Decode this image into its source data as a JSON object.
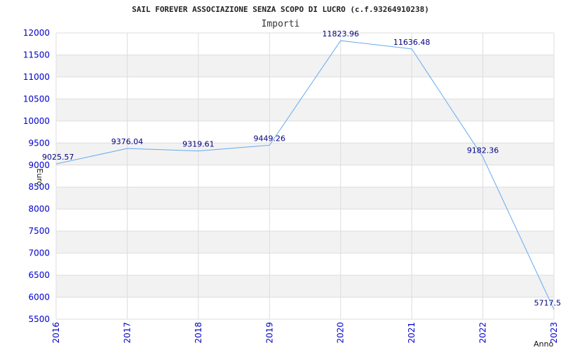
{
  "chart_data": {
    "type": "line",
    "title": "SAIL FOREVER ASSOCIAZIONE SENZA SCOPO DI LUCRO (c.f.93264910238)",
    "subtitle": "Importi",
    "xlabel": "Anno",
    "ylabel": "Euro",
    "categories": [
      "2016",
      "2017",
      "2018",
      "2019",
      "2020",
      "2021",
      "2022",
      "2023"
    ],
    "series": [
      {
        "values": [
          9025.57,
          9376.04,
          9319.61,
          9449.26,
          11823.96,
          11636.48,
          9182.36,
          5717.5
        ],
        "labels": [
          "9025.57",
          "9376.04",
          "9319.61",
          "9449.26",
          "11823.96",
          "11636.48",
          "9182.36",
          "5717.5"
        ]
      }
    ],
    "ylim": [
      5500,
      12000
    ],
    "yticks": [
      5500,
      6000,
      6500,
      7000,
      7500,
      8000,
      8500,
      9000,
      9500,
      10000,
      10500,
      11000,
      11500,
      12000
    ],
    "grid": true,
    "line_color": "#66aaee",
    "band_color": "#f2f2f2",
    "tick_color": "#0000cc",
    "label_color": "#000080"
  }
}
